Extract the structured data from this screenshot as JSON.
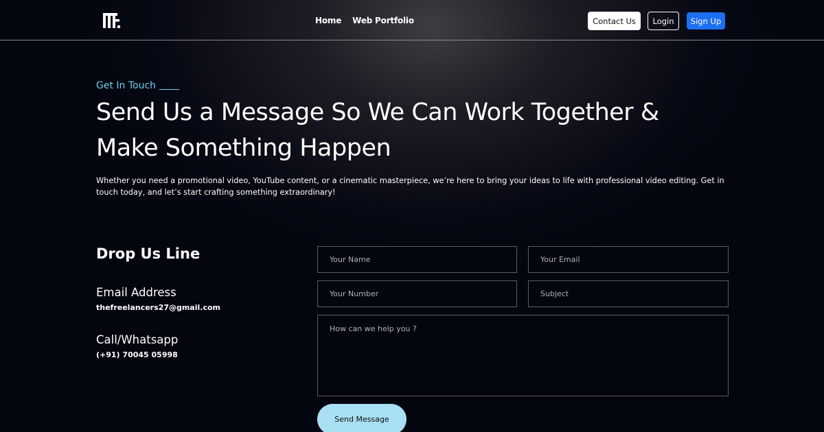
{
  "header": {
    "logo_text": "TF.",
    "nav": [
      {
        "label": "Home"
      },
      {
        "label": "Web Portfolio"
      }
    ],
    "contact_label": "Contact Us",
    "login_label": "Login",
    "signup_label": "Sign Up"
  },
  "hero": {
    "eyebrow": "Get In Touch",
    "headline": "Send Us a Message So We Can Work Together & Make Something Happen",
    "intro": "Whether you need a promotional video, YouTube content, or a cinematic masterpiece, we’re here to bring your ideas to life with professional video editing. Get in touch today, and let’s start crafting something extraordinary!"
  },
  "contact": {
    "title": "Drop Us Line",
    "email_label": "Email Address",
    "email_value": "thefreelancers27@gmail.com",
    "phone_label": "Call/Whatsapp",
    "phone_value": "(+91) 70045 05998"
  },
  "form": {
    "name_placeholder": "Your Name",
    "email_placeholder": "Your Email",
    "number_placeholder": "Your Number",
    "subject_placeholder": "Subject",
    "message_placeholder": "How can we help you ?",
    "send_label": "Send Message"
  },
  "colors": {
    "background": "#03050f",
    "accent": "#6fd0ee",
    "signup": "#1d6ff2",
    "send_button": "#a9dff2"
  }
}
